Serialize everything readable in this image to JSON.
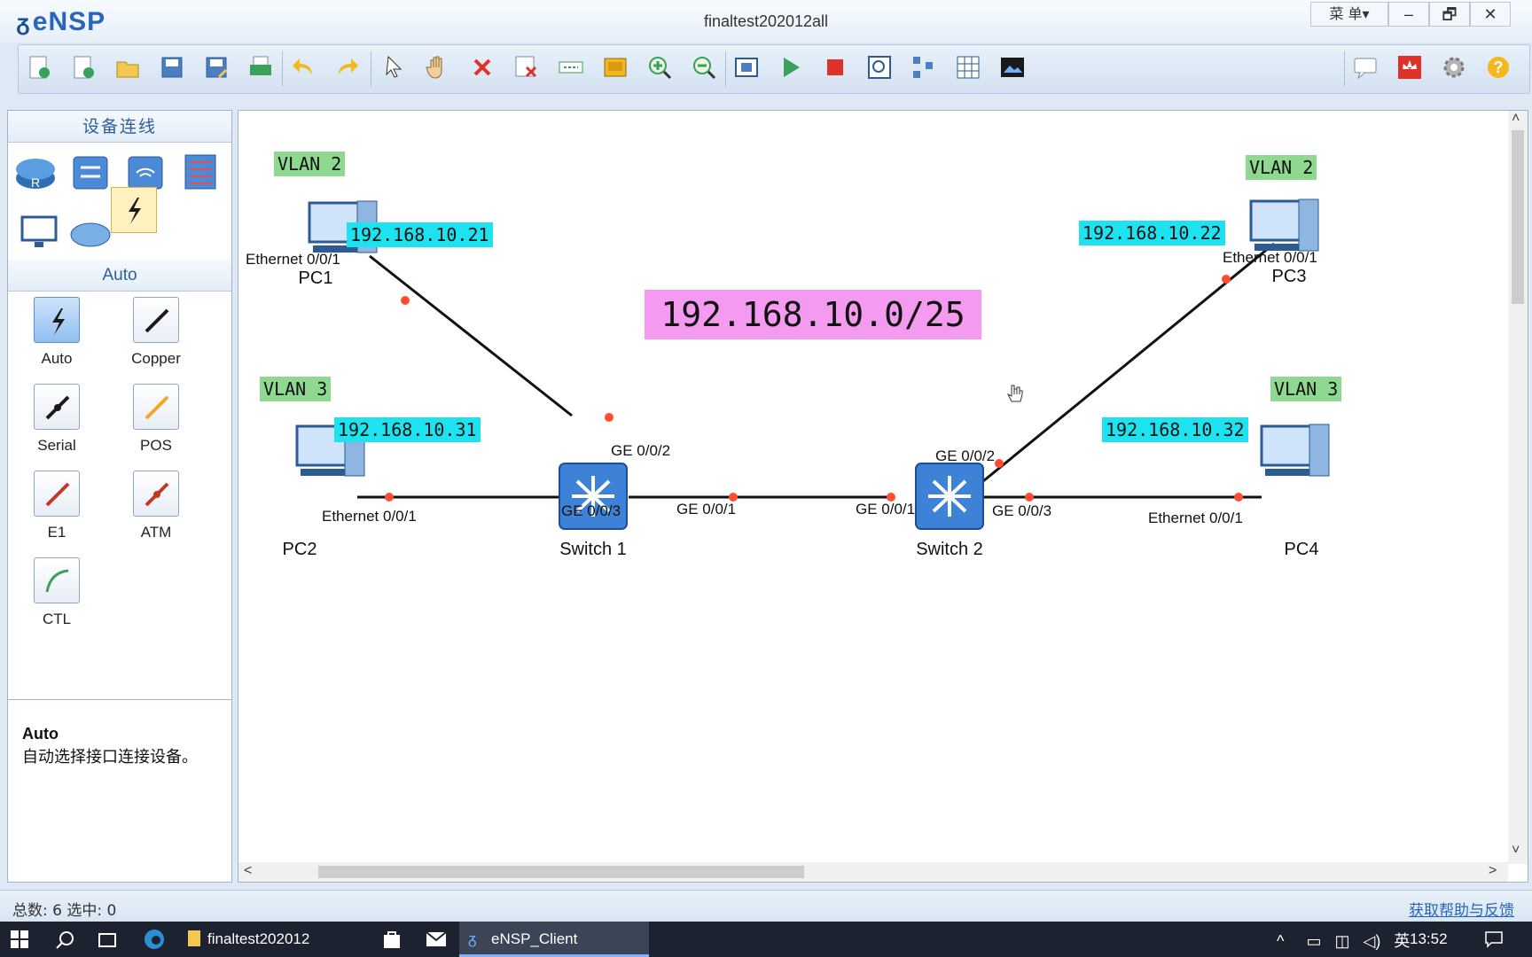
{
  "window": {
    "app_name": "eNSP",
    "title": "finaltest202012all",
    "menu_label": "菜 单▾",
    "minimize": "–",
    "restore": "🗗",
    "close": "✕"
  },
  "toolbar": {
    "buttons": [
      "new-topology",
      "new-example",
      "open",
      "save",
      "save-as",
      "print",
      "undo",
      "redo",
      "select",
      "pan",
      "delete",
      "delete-all-links",
      "text",
      "palette",
      "zoom-in",
      "zoom-out",
      "fit",
      "start",
      "stop",
      "capture",
      "topology-manage",
      "grid",
      "screenshot"
    ],
    "right_buttons": [
      "chat",
      "huawei",
      "settings",
      "help"
    ]
  },
  "left_panel": {
    "devices_title": "设备连线",
    "device_icons": [
      "router-icon",
      "switch-icon",
      "wlan-icon",
      "firewall-icon",
      "pc-icon",
      "cloud-icon",
      "cable-icon"
    ],
    "cable_title": "Auto",
    "cables": [
      {
        "label": "Auto",
        "color": "#1a1a1a",
        "selected": true
      },
      {
        "label": "Copper",
        "color": "#1a1a1a",
        "selected": false
      },
      {
        "label": "Serial",
        "color": "#1a1a1a",
        "selected": false
      },
      {
        "label": "POS",
        "color": "#f5a623",
        "selected": false
      },
      {
        "label": "E1",
        "color": "#c0392b",
        "selected": false
      },
      {
        "label": "ATM",
        "color": "#c0392b",
        "selected": false
      },
      {
        "label": "CTL",
        "color": "#3aa05a",
        "selected": false
      }
    ],
    "description": {
      "title": "Auto",
      "text": "自动选择接口连接设备。"
    }
  },
  "topology": {
    "network": "192.168.10.0/25",
    "pcs": [
      {
        "name": "PC1",
        "vlan": "VLAN 2",
        "ip": "192.168.10.21",
        "port": "Ethernet 0/0/1"
      },
      {
        "name": "PC2",
        "vlan": "VLAN 3",
        "ip": "192.168.10.31",
        "port": "Ethernet 0/0/1"
      },
      {
        "name": "PC3",
        "vlan": "VLAN 2",
        "ip": "192.168.10.22",
        "port": "Ethernet 0/0/1"
      },
      {
        "name": "PC4",
        "vlan": "VLAN 3",
        "ip": "192.168.10.32",
        "port": "Ethernet 0/0/1"
      }
    ],
    "switches": [
      {
        "name": "Switch 1",
        "ports": {
          "to_pc1": "GE 0/0/2",
          "to_pc2": "GE 0/0/3",
          "to_sw": "GE 0/0/1"
        }
      },
      {
        "name": "Switch 2",
        "ports": {
          "to_pc3": "GE 0/0/2",
          "to_pc4": "GE 0/0/3",
          "to_sw": "GE 0/0/1"
        }
      }
    ],
    "colors": {
      "vlan_bg": "#8fd88f",
      "ip_bg": "#1de3f0",
      "network_bg": "#f49af0",
      "port_dot": "#ff4d2e"
    }
  },
  "status": {
    "left": "总数: 6  选中: 0",
    "right": "获取帮助与反馈"
  },
  "taskbar": {
    "folder": "finaltest202012",
    "app": "eNSP_Client",
    "ime": "英",
    "time": "13:52"
  }
}
